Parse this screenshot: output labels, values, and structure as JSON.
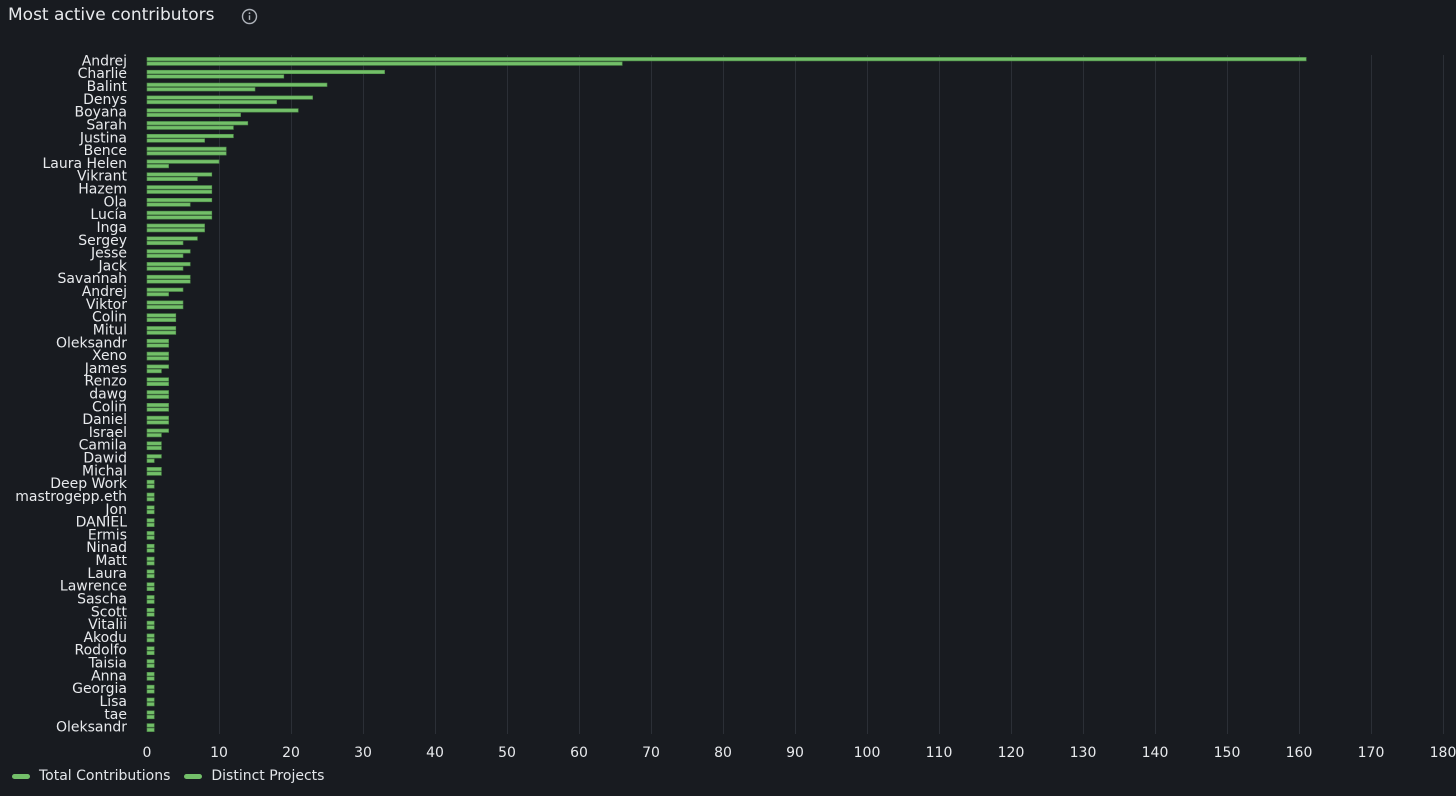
{
  "header": {
    "title": "Most active contributors",
    "info_icon": "info-circle-icon"
  },
  "colors": {
    "background": "#181b20",
    "grid": "#2b2f36",
    "bar_fill": "#73bf69",
    "bar_stroke": "#4f8f4a",
    "axis_text": "#e8eaed"
  },
  "chart_data": {
    "type": "bar",
    "orientation": "horizontal",
    "title": "Most active contributors",
    "xlabel": "",
    "ylabel": "",
    "xlim": [
      0,
      180
    ],
    "x_ticks": [
      0,
      10,
      20,
      30,
      40,
      50,
      60,
      70,
      80,
      90,
      100,
      110,
      120,
      130,
      140,
      150,
      160,
      170,
      180
    ],
    "grid": true,
    "legend_position": "bottom-left",
    "categories": [
      "Andrej",
      "Charlie",
      "Balint",
      "Denys",
      "Boyana",
      "Sarah",
      "Justina",
      "Bence",
      "Laura Helen",
      "Vikrant",
      "Hazem",
      "Ola",
      "Lucía",
      "Inga",
      "Sergey",
      "Jesse",
      "Jack",
      "Savannah",
      "Andrej",
      "Viktor",
      "Colin",
      "Mitul",
      "Oleksandr",
      "Xeno",
      "James",
      "Renzo",
      "dawg",
      "Colin",
      "Daniel",
      "Israel",
      "Camila",
      "Dawid",
      "Michal",
      "Deep Work",
      "mastrogepp.eth",
      "Jon",
      "DANIEL",
      "Ermis",
      "Ninad",
      "Matt",
      "Laura",
      "Lawrence",
      "Sascha",
      "Scott",
      "Vitalii",
      "Akodu",
      "Rodolfo",
      "Taisia",
      "Anna",
      "Georgia",
      "Lisa",
      "tae",
      "Oleksandr"
    ],
    "series": [
      {
        "name": "Total Contributions",
        "values": [
          161,
          33,
          25,
          23,
          21,
          14,
          12,
          11,
          10,
          9,
          9,
          9,
          9,
          8,
          7,
          6,
          6,
          6,
          5,
          5,
          4,
          4,
          3,
          3,
          3,
          3,
          3,
          3,
          3,
          3,
          2,
          2,
          2,
          1,
          1,
          1,
          1,
          1,
          1,
          1,
          1,
          1,
          1,
          1,
          1,
          1,
          1,
          1,
          1,
          1,
          1,
          1,
          1
        ]
      },
      {
        "name": "Distinct Projects",
        "values": [
          66,
          19,
          15,
          18,
          13,
          12,
          8,
          11,
          3,
          7,
          9,
          6,
          9,
          8,
          5,
          5,
          5,
          6,
          3,
          5,
          4,
          4,
          3,
          3,
          2,
          3,
          3,
          3,
          3,
          2,
          2,
          1,
          2,
          1,
          1,
          1,
          1,
          1,
          1,
          1,
          1,
          1,
          1,
          1,
          1,
          1,
          1,
          1,
          1,
          1,
          1,
          1,
          1
        ]
      }
    ]
  }
}
